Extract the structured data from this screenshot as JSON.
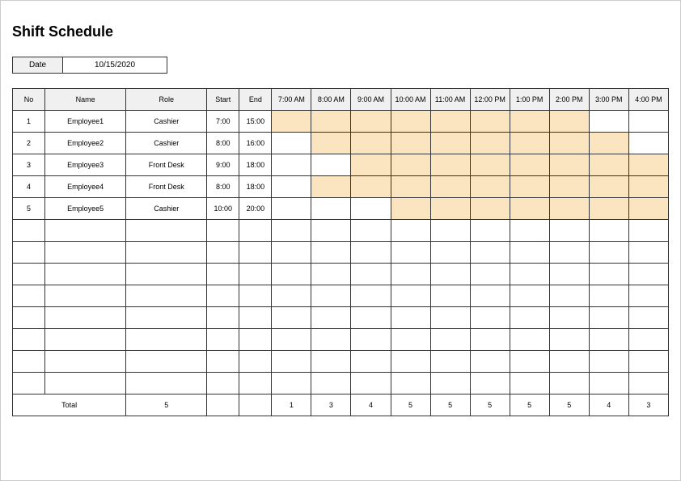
{
  "title": "Shift Schedule",
  "date_label": "Date",
  "date_value": "10/15/2020",
  "headers": {
    "no": "No",
    "name": "Name",
    "role": "Role",
    "start": "Start",
    "end": "End"
  },
  "hours": [
    "7:00 AM",
    "8:00 AM",
    "9:00 AM",
    "10:00 AM",
    "11:00 AM",
    "12:00 PM",
    "1:00 PM",
    "2:00 PM",
    "3:00 PM",
    "4:00 PM"
  ],
  "rows": [
    {
      "no": "1",
      "name": "Employee1",
      "role": "Cashier",
      "start": "7:00",
      "end": "15:00",
      "shift": [
        true,
        true,
        true,
        true,
        true,
        true,
        true,
        true,
        false,
        false
      ]
    },
    {
      "no": "2",
      "name": "Employee2",
      "role": "Cashier",
      "start": "8:00",
      "end": "16:00",
      "shift": [
        false,
        true,
        true,
        true,
        true,
        true,
        true,
        true,
        true,
        false
      ]
    },
    {
      "no": "3",
      "name": "Employee3",
      "role": "Front Desk",
      "start": "9:00",
      "end": "18:00",
      "shift": [
        false,
        false,
        true,
        true,
        true,
        true,
        true,
        true,
        true,
        true
      ]
    },
    {
      "no": "4",
      "name": "Employee4",
      "role": "Front Desk",
      "start": "8:00",
      "end": "18:00",
      "shift": [
        false,
        true,
        true,
        true,
        true,
        true,
        true,
        true,
        true,
        true
      ]
    },
    {
      "no": "5",
      "name": "Employee5",
      "role": "Cashier",
      "start": "10:00",
      "end": "20:00",
      "shift": [
        false,
        false,
        false,
        true,
        true,
        true,
        true,
        true,
        true,
        true
      ]
    }
  ],
  "empty_rows": 8,
  "totals": {
    "label": "Total",
    "count": "5",
    "hours": [
      "1",
      "3",
      "4",
      "5",
      "5",
      "5",
      "5",
      "5",
      "4",
      "3"
    ]
  },
  "chart_data": {
    "type": "table",
    "title": "Shift Schedule",
    "date": "10/15/2020",
    "columns": [
      "No",
      "Name",
      "Role",
      "Start",
      "End",
      "7:00 AM",
      "8:00 AM",
      "9:00 AM",
      "10:00 AM",
      "11:00 AM",
      "12:00 PM",
      "1:00 PM",
      "2:00 PM",
      "3:00 PM",
      "4:00 PM"
    ],
    "employees": [
      {
        "no": 1,
        "name": "Employee1",
        "role": "Cashier",
        "start": "7:00",
        "end": "15:00"
      },
      {
        "no": 2,
        "name": "Employee2",
        "role": "Cashier",
        "start": "8:00",
        "end": "16:00"
      },
      {
        "no": 3,
        "name": "Employee3",
        "role": "Front Desk",
        "start": "9:00",
        "end": "18:00"
      },
      {
        "no": 4,
        "name": "Employee4",
        "role": "Front Desk",
        "start": "8:00",
        "end": "18:00"
      },
      {
        "no": 5,
        "name": "Employee5",
        "role": "Cashier",
        "start": "10:00",
        "end": "20:00"
      }
    ],
    "totals_per_hour": {
      "7:00 AM": 1,
      "8:00 AM": 3,
      "9:00 AM": 4,
      "10:00 AM": 5,
      "11:00 AM": 5,
      "12:00 PM": 5,
      "1:00 PM": 5,
      "2:00 PM": 5,
      "3:00 PM": 4,
      "4:00 PM": 3
    },
    "total_employees": 5
  }
}
